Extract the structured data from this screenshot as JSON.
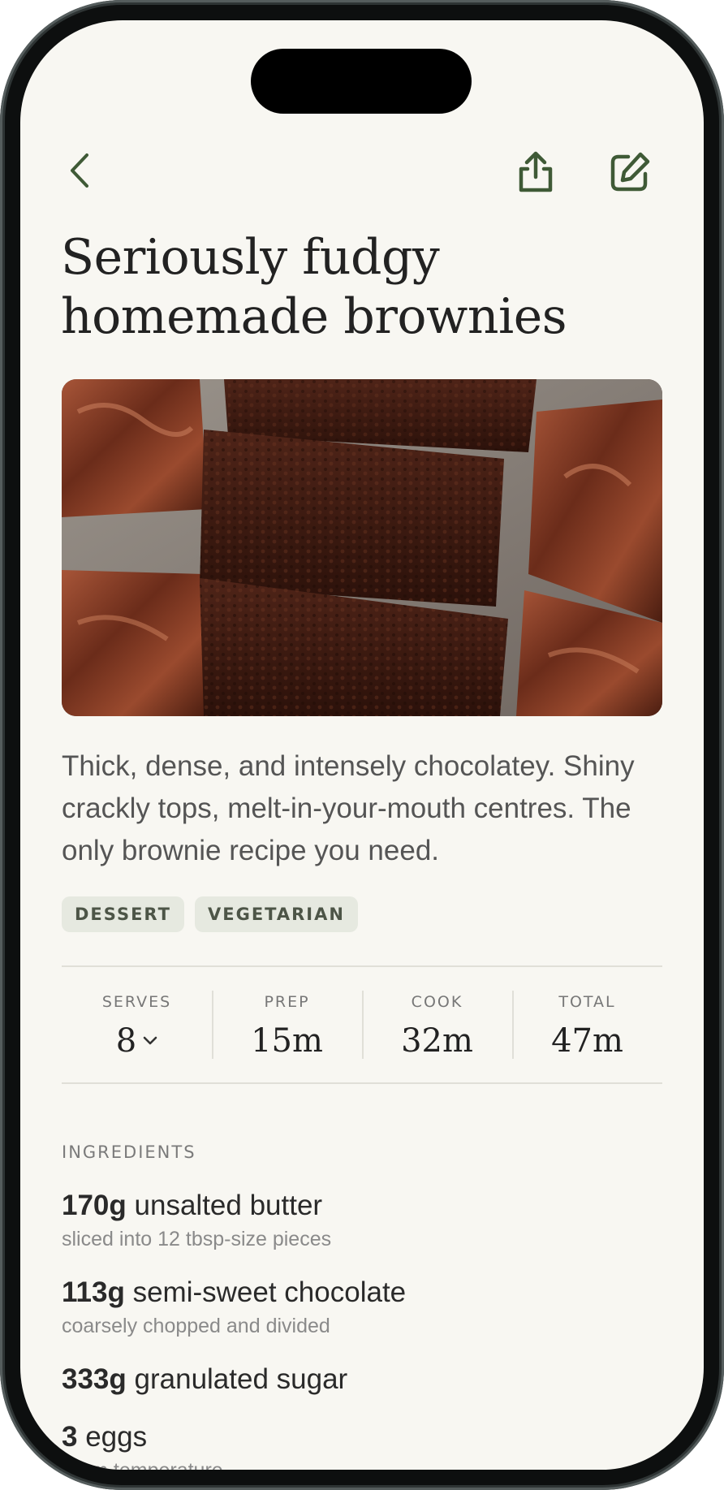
{
  "colors": {
    "accent": "#3f5a36",
    "background": "#f8f7f2",
    "title_text": "#222222",
    "tag_bg": "#e6e9e0"
  },
  "nav": {
    "back_icon": "chevron-left-icon",
    "share_icon": "share-icon",
    "edit_icon": "edit-icon"
  },
  "recipe": {
    "title": "Seriously fudgy homemade brownies",
    "image_alt_icon": "brownie-photo",
    "description": "Thick, dense, and intensely chocolatey. Shiny crackly tops, melt-in-your-mouth centres. The only brownie recipe you need.",
    "tags": [
      "DESSERT",
      "VEGETARIAN"
    ]
  },
  "stats": {
    "serves_label": "SERVES",
    "serves_value": "8",
    "prep_label": "PREP",
    "prep_value": "15m",
    "cook_label": "COOK",
    "cook_value": "32m",
    "total_label": "TOTAL",
    "total_value": "47m"
  },
  "ingredients": {
    "section_label": "INGREDIENTS",
    "items": [
      {
        "qty": "170g",
        "name": "unsalted butter",
        "note": "sliced into 12 tbsp-size pieces"
      },
      {
        "qty": "113g",
        "name": "semi-sweet chocolate",
        "note": "coarsely chopped and divided"
      },
      {
        "qty": "333g",
        "name": "granulated sugar",
        "note": ""
      },
      {
        "qty": "3",
        "name": "eggs",
        "note": "room temperature"
      }
    ]
  }
}
